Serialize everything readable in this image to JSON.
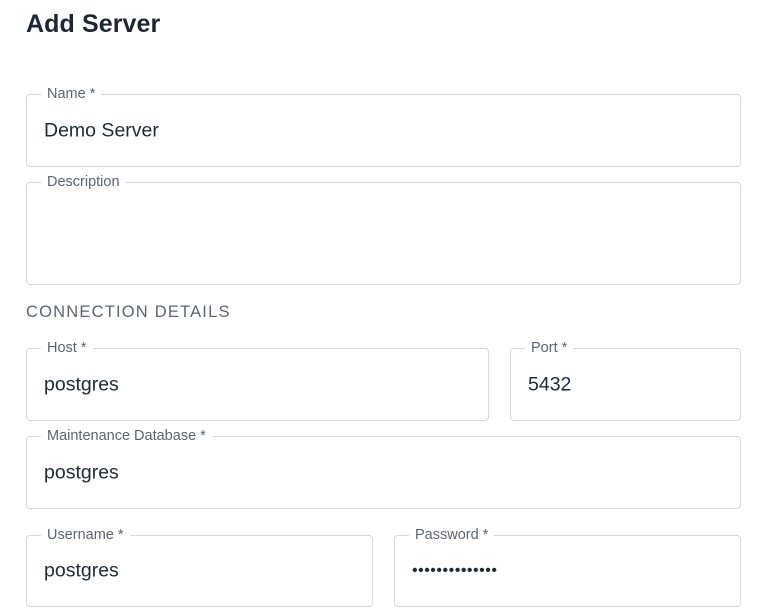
{
  "header": {
    "title": "Add Server"
  },
  "form": {
    "name": {
      "label": "Name *",
      "value": "Demo Server"
    },
    "description": {
      "label": "Description",
      "value": ""
    },
    "connection_heading": "CONNECTION DETAILS",
    "host": {
      "label": "Host *",
      "value": "postgres"
    },
    "port": {
      "label": "Port *",
      "value": "5432"
    },
    "maintenance_db": {
      "label": "Maintenance Database *",
      "value": "postgres"
    },
    "username": {
      "label": "Username *",
      "value": "postgres"
    },
    "password": {
      "label": "Password *",
      "value": "••••••••••••••"
    }
  }
}
